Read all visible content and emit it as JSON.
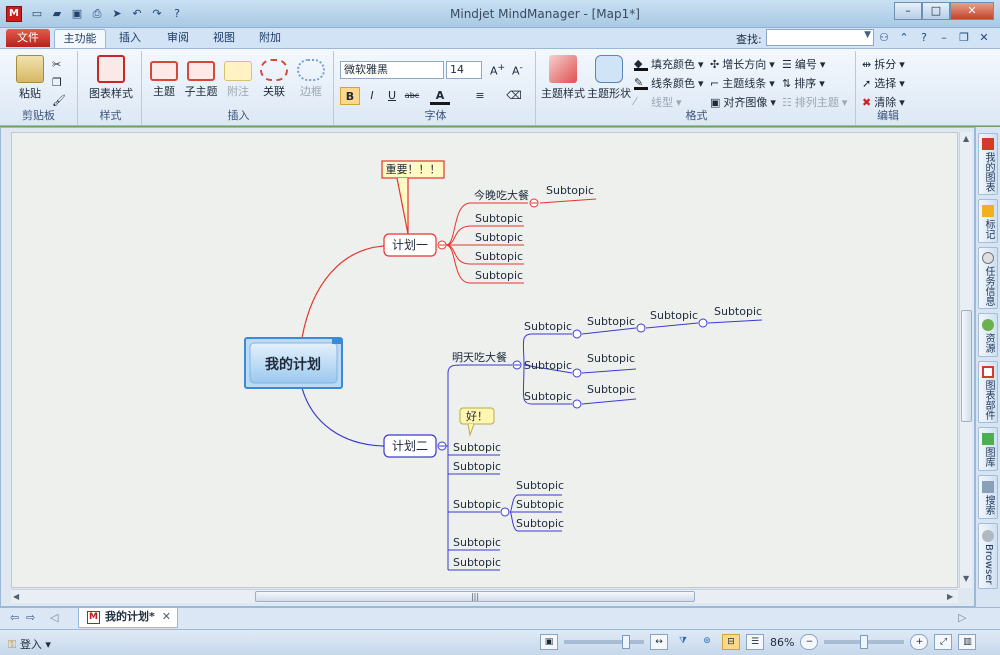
{
  "window": {
    "app_icon": "M",
    "title": "Mindjet MindManager - [Map1*]",
    "minimize": "–",
    "maximize": "□",
    "close": "✕"
  },
  "ribbon_tabs": {
    "file": "文件",
    "tabs": [
      "主功能",
      "插入",
      "审阅",
      "视图",
      "附加"
    ],
    "active_index": 0
  },
  "find": {
    "label": "查找:",
    "value": ""
  },
  "ribbon": {
    "clipboard": {
      "paste": "粘贴",
      "group": "剪贴板"
    },
    "styles": {
      "map_style": "图表样式",
      "group": "样式"
    },
    "insert": {
      "topic": "主题",
      "subtopic": "子主题",
      "callout": "附注",
      "relationship": "关联",
      "boundary": "边框",
      "group": "插入"
    },
    "font": {
      "family": "微软雅黑",
      "size": "14",
      "bold": "B",
      "italic": "I",
      "underline": "U",
      "strike": "abc",
      "color": "A",
      "group": "字体"
    },
    "format": {
      "topic_style": "主题样式",
      "topic_shape": "主题形状",
      "fill_color": "填充颜色",
      "line_color": "线条颜色",
      "line_style": "线型",
      "grow_direction": "增长方向",
      "topic_lines": "主题线条",
      "align_images": "对齐图像",
      "numbering": "编号",
      "sort": "排序",
      "arrange_topics": "排列主题",
      "group": "格式"
    },
    "editing": {
      "split": "拆分",
      "select": "选择",
      "clear": "清除",
      "group": "编辑"
    }
  },
  "mindmap": {
    "central": "我的计划",
    "plan1": {
      "label": "计划一",
      "callout": "重要！！！",
      "child1": "今晚吃大餐",
      "child1_sub": "Subtopic",
      "subs": [
        "Subtopic",
        "Subtopic",
        "Subtopic",
        "Subtopic"
      ]
    },
    "plan2": {
      "label": "计划二",
      "callout": "好！",
      "child1": "明天吃大餐",
      "child1_row1": [
        "Subtopic",
        "Subtopic",
        "Subtopic",
        "Subtopic"
      ],
      "child1_row2": [
        "Subtopic",
        "Subtopic"
      ],
      "child1_row3": [
        "Subtopic",
        "Subtopic"
      ],
      "subs": [
        "Subtopic",
        "Subtopic",
        "Subtopic",
        "Subtopic",
        "Subtopic"
      ],
      "sub3_children": [
        "Subtopic",
        "Subtopic",
        "Subtopic"
      ]
    }
  },
  "side_tabs": [
    "我的图表",
    "标记",
    "任务信息",
    "资源",
    "图表部件",
    "图库",
    "搜索",
    "Browser"
  ],
  "doc_tab": {
    "label": "我的计划*",
    "icon": "M",
    "close": "✕"
  },
  "status": {
    "login": "登入",
    "zoom": "86%"
  },
  "colors": {
    "plan1": "#e8332a",
    "plan2": "#3a3ad0",
    "central_fill": "#a9d0f0",
    "callout1": "#fff9c4",
    "callout2": "#fff7b0"
  }
}
